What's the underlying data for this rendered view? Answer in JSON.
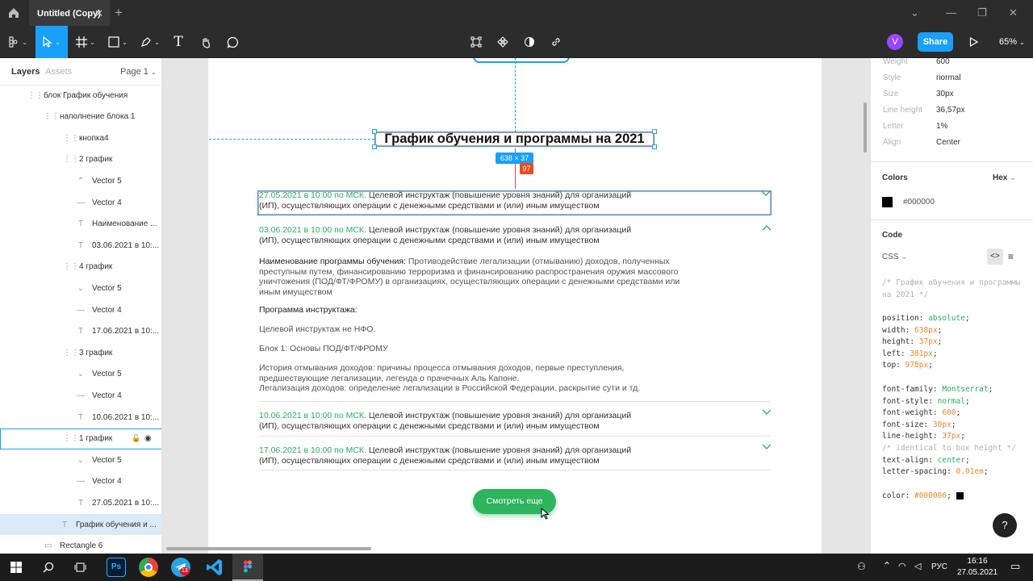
{
  "window": {
    "tab_title": "Untitled (Copy)"
  },
  "toolbar": {
    "avatar_letter": "V",
    "share_label": "Share",
    "zoom_label": "65%"
  },
  "left_panel": {
    "tabs": [
      "Layers",
      "Assets"
    ],
    "page_label": "Page 1",
    "layers": [
      {
        "label": "блок График обучения"
      },
      {
        "label": "наполнение блока 1"
      },
      {
        "label": "кнопка4"
      },
      {
        "label": "2 график"
      },
      {
        "label": "Vector 5"
      },
      {
        "label": "Vector 4"
      },
      {
        "label": "Наименование ..."
      },
      {
        "label": "03.06.2021 в 10:..."
      },
      {
        "label": "4 график"
      },
      {
        "label": "Vector 5"
      },
      {
        "label": "Vector 4"
      },
      {
        "label": "17.06.2021 в 10:..."
      },
      {
        "label": "3 график"
      },
      {
        "label": "Vector 5"
      },
      {
        "label": "Vector 4"
      },
      {
        "label": "10.06.2021 в 10:..."
      },
      {
        "label": "1 график"
      },
      {
        "label": "Vector 5"
      },
      {
        "label": "Vector 4"
      },
      {
        "label": "27.05.2021 в 10:..."
      },
      {
        "label": "График обучения и ..."
      },
      {
        "label": "Rectangle 6"
      }
    ]
  },
  "canvas": {
    "heading": "График обучения и программы на 2021",
    "size_badge": "638 × 37",
    "spacing_badge": "97",
    "item1_date": "27.05.2021 в 10:00 по МСК.",
    "item1_text": " Целевой инструктаж (повышение уровня знаний) для организаций",
    "item1_text2": "(ИП), осуществляющих операции с денежными средствами и (или) иным имуществом",
    "item2_date": "03.06.2021 в 10:00 по МСК.",
    "item2_text": " Целевой инструктаж (повышение уровня знаний) для организаций",
    "item2_text2": "(ИП), осуществляющих операции с денежными средствами и (или) иным имуществом",
    "program_label": "Наименование программы обучения:",
    "program_text1": " Противодействие легализации (отмыванию) доходов, полученных",
    "program_text2": "преступным путем, финансированию терроризма и финансированию распространения оружия массового",
    "program_text3": "уничтожения (ПОД/ФТ/ФРОМУ) в организациях, осуществляющих операции с денежными средствами или",
    "program_text4": "иным имуществом",
    "instr_title": "Программа инструктажа:",
    "instr_1": "Целевой инструктаж не НФО.",
    "instr_2": "Блок 1: Основы ПОД/ФТ/ФРОМУ",
    "instr_3a": "История отмывания доходов: причины процесса отмывания доходов, первые преступления,",
    "instr_3b": "предшествующие легализации, легенда о прачечных Аль Капоне.",
    "instr_3c": "Легализация доходов: определение легализации в Российской Федерации, раскрытие сути и тд.",
    "item3_date": "10.06.2021 в 10:00 по МСК.",
    "item3_text": " Целевой инструктаж (повышение уровня знаний) для организаций",
    "item3_text2": "(ИП), осуществляющих операции с денежными средствами и (или) иным имуществом",
    "item4_date": "17.06.2021 в 10:00 по МСК.",
    "item4_text": " Целевой инструктаж (повышение уровня знаний) для организаций",
    "item4_text2": "(ИП), осуществляющих операции с денежными средствами и (или) иным имуществом",
    "button_label": "Смотреть еще"
  },
  "right_panel": {
    "props": [
      {
        "label": "Weight",
        "value": "600"
      },
      {
        "label": "Style",
        "value": "normal"
      },
      {
        "label": "Size",
        "value": "30px"
      },
      {
        "label": "Line height",
        "value": "36,57px"
      },
      {
        "label": "Letter",
        "value": "1%"
      },
      {
        "label": "Align",
        "value": "Center"
      }
    ],
    "colors_title": "Colors",
    "color_format": "Hex",
    "color_value": "#000000",
    "code_title": "Code",
    "code_lang": "CSS",
    "help_label": "?"
  },
  "taskbar": {
    "lang": "РУС",
    "time": "16:16",
    "date": "27.05.2021",
    "badge": "13"
  },
  "colors": {
    "accent": "#18a0fb",
    "green": "#27ae60",
    "red": "#f24822"
  }
}
